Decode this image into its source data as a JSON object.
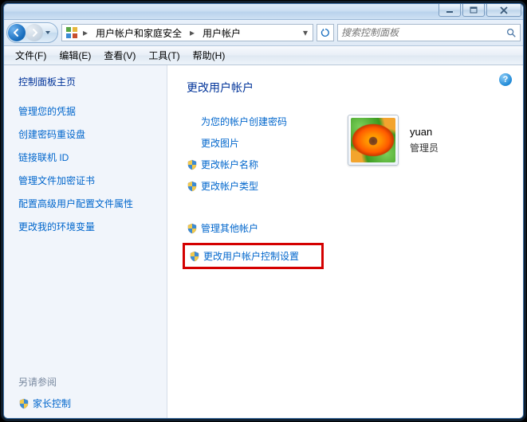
{
  "window_buttons": {
    "minimize": "_",
    "maximize": "□",
    "close": "×"
  },
  "breadcrumb": {
    "seg1": "用户帐户和家庭安全",
    "seg2": "用户帐户"
  },
  "search": {
    "placeholder": "搜索控制面板"
  },
  "menu": {
    "file": "文件(F)",
    "edit": "编辑(E)",
    "view": "查看(V)",
    "tools": "工具(T)",
    "help": "帮助(H)"
  },
  "sidebar": {
    "home": "控制面板主页",
    "links": [
      "管理您的凭据",
      "创建密码重设盘",
      "链接联机 ID",
      "管理文件加密证书",
      "配置高级用户配置文件属性",
      "更改我的环境变量"
    ],
    "see_also": "另请参阅",
    "parental": "家长控制"
  },
  "content": {
    "heading": "更改用户帐户",
    "actions1": [
      {
        "label": "为您的帐户创建密码",
        "shield": false
      },
      {
        "label": "更改图片",
        "shield": false
      },
      {
        "label": "更改帐户名称",
        "shield": true
      },
      {
        "label": "更改帐户类型",
        "shield": true
      }
    ],
    "actions2": [
      {
        "label": "管理其他帐户",
        "shield": true
      },
      {
        "label": "更改用户帐户控制设置",
        "shield": true,
        "highlighted": true
      }
    ]
  },
  "user": {
    "name": "yuan",
    "role": "管理员"
  },
  "help_icon": "?"
}
